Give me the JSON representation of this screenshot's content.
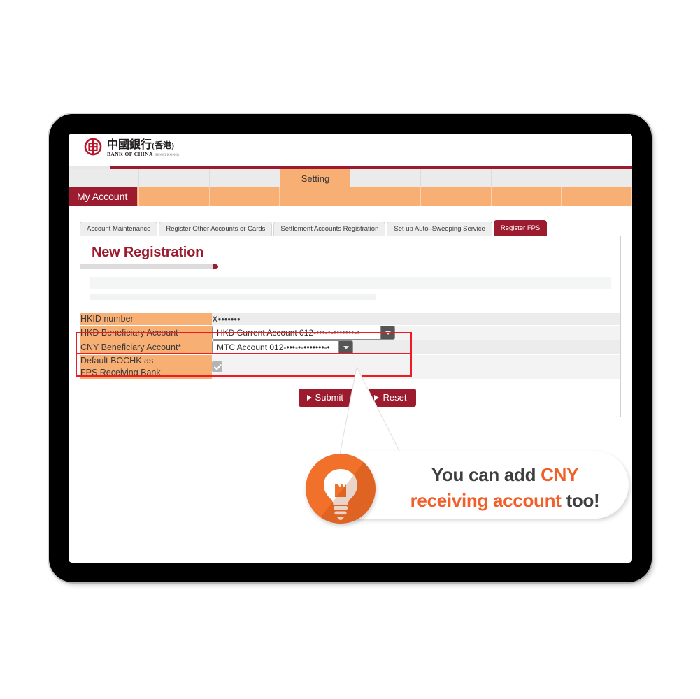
{
  "bank": {
    "logo_cn": "中國銀行",
    "logo_cn_region": "(香港)",
    "logo_en": "BANK OF CHINA",
    "logo_en_sub": "(HONG KONG)"
  },
  "topnav": {
    "active_label": "Setting"
  },
  "sectionbar": {
    "label": "My Account"
  },
  "subtabs": [
    {
      "label": "Account Maintenance",
      "active": false
    },
    {
      "label": "Register Other Accounts or Cards",
      "active": false
    },
    {
      "label": "Settlement Accounts Registration",
      "active": false
    },
    {
      "label": "Set up Auto–Sweeping Service",
      "active": false
    },
    {
      "label": "Register FPS",
      "active": true
    }
  ],
  "panel": {
    "title": "New Registration"
  },
  "form": {
    "rows": [
      {
        "label": "HKID number",
        "value": "X•••••••",
        "type": "text"
      },
      {
        "label": "HKD Beneficiary Account",
        "value": "HKD Current Account 012-•••-•-•••••••-•",
        "type": "select",
        "highlighted": true
      },
      {
        "label": "CNY Beneficiary Account*",
        "value": "MTC Account 012-•••-•-•••••••-•",
        "type": "select",
        "highlighted": true
      },
      {
        "label": "Default BOCHK as FPS Receiving Bank",
        "label_line1": "Default BOCHK as",
        "label_line2": "FPS Receiving Bank",
        "value": "checked",
        "type": "checkbox"
      }
    ]
  },
  "buttons": {
    "submit": "Submit",
    "reset": "Reset"
  },
  "callout": {
    "line1_plain": "You can add ",
    "line1_accent": "CNY",
    "line2_accent": "receiving account",
    "line2_plain": " too!",
    "icon": "lightbulb-icon"
  },
  "colors": {
    "brand_red": "#9c1b2e",
    "accent_orange": "#f8af74",
    "callout_orange": "#f1702a",
    "highlight_red": "#ee1b24"
  }
}
